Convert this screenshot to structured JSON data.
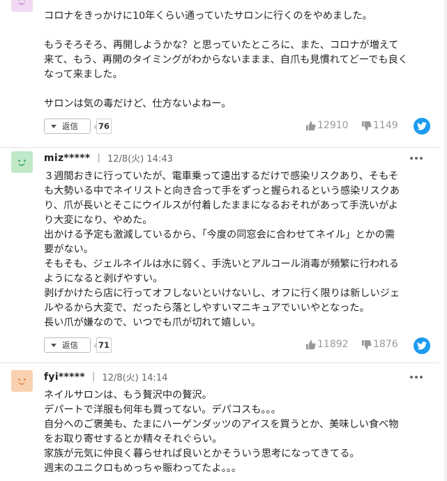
{
  "colors": {
    "twitter": "#1d9bf0",
    "meta_text": "#666666",
    "vote_text": "#999999"
  },
  "comments": [
    {
      "avatar": {
        "bg": "#f0d9f1",
        "fg": "#c98fd0"
      },
      "user": "",
      "date": "",
      "body": [
        "コロナをきっかけに10年くらい通っていたサロンに行くのをやめました。",
        "",
        "もうそろそろ、再開しようかな？と思っていたところに、また、コロナが増えて",
        "来て、もう、再開のタイミングがわからないままま、自爪も見慣れてどーでも良く",
        "なって来ました。",
        "",
        "サロンは気の毒だけど、仕方ないよねー。"
      ],
      "reply_label": "返信",
      "reply_count": "76",
      "likes": "12910",
      "dislikes": "1149"
    },
    {
      "avatar": {
        "bg": "#bfe9c8",
        "fg": "#4aa864"
      },
      "user": "miz*****",
      "date": "12/8(火) 14:43",
      "body": [
        "３週間おきに行っていたが、電車乗って遠出するだけで感染リスクあり、そもそ",
        "も大勢いる中でネイリストと向き合って手をずっと握られるという感染リスクあ",
        "り、爪が長いとそこにウイルスが付着したままになるおそれがあって手洗いがよ",
        "り大変になり、やめた。",
        "出かける予定も激減しているから、「今度の同窓会に合わせてネイル」とかの需",
        "要がない。",
        "そもそも、ジェルネイルは水に弱く、手洗いとアルコール消毒が頻繁に行われる",
        "ようになると剥げやすい。",
        "剥げかけたら店に行ってオフしないといけないし、オフに行く限りは新しいジェ",
        "ルやるから大変で、だったら落としやすいマニキュアでいいやとなった。",
        "長い爪が嫌なので、いつでも爪が切れて嬉しい。"
      ],
      "reply_label": "返信",
      "reply_count": "71",
      "likes": "11892",
      "dislikes": "1876"
    },
    {
      "avatar": {
        "bg": "#f9d1b0",
        "fg": "#e08a4a"
      },
      "user": "fyi*****",
      "date": "12/8(火) 14:14",
      "body": [
        "ネイルサロンは、もう贅沢中の贅沢。",
        "デパートで洋服も何年も買ってない。デパコスも。。。",
        "自分へのご褒美も、たまにハーゲンダッツのアイスを買うとか、美味しい食べ物",
        "をお取り寄せするとか精々それぐらい。",
        "家族が元気に仲良く暮らせれば良いとかそういう思考になってきてる。",
        "週末のユニクロもめっちゃ賑わってたよ。。。"
      ]
    }
  ]
}
